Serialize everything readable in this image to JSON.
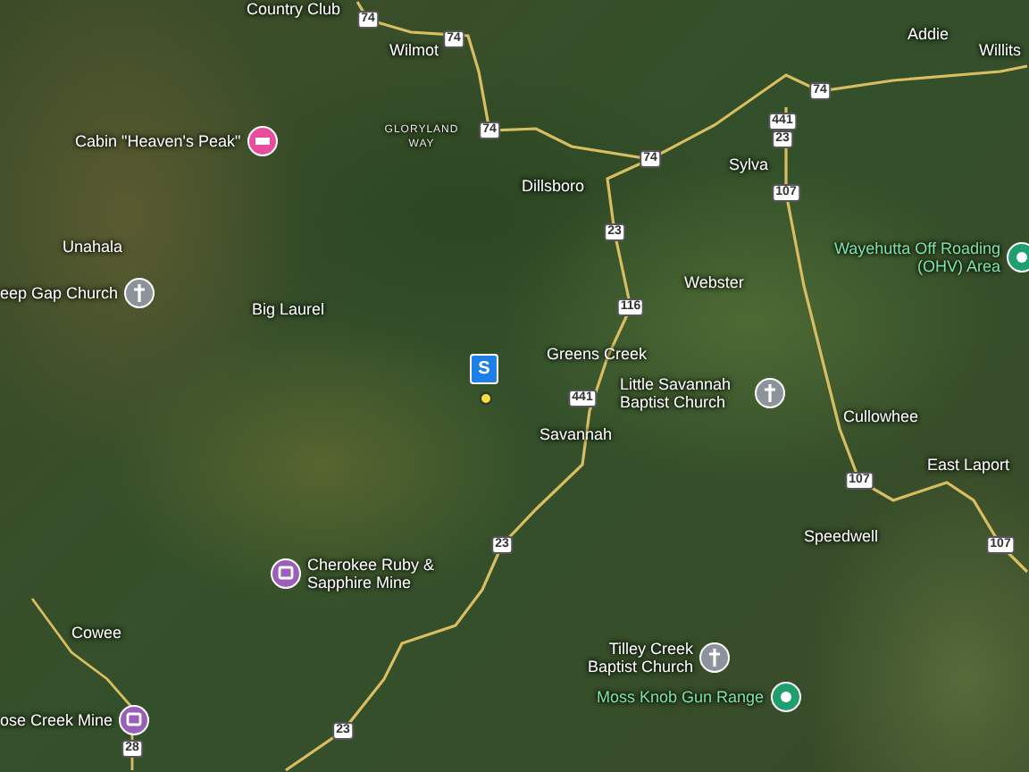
{
  "map": {
    "places": [
      {
        "name": "Country Club",
        "kind": "town"
      },
      {
        "name": "Wilmot",
        "kind": "town"
      },
      {
        "name": "Cabin \"Heaven's Peak\"",
        "kind": "lodging"
      },
      {
        "name": "GLORYLAND WAY",
        "kind": "road"
      },
      {
        "name": "Addie",
        "kind": "town"
      },
      {
        "name": "Willits",
        "kind": "town"
      },
      {
        "name": "Sylva",
        "kind": "town"
      },
      {
        "name": "Dillsboro",
        "kind": "town"
      },
      {
        "name": "Unahala",
        "kind": "town"
      },
      {
        "name": "Wayehutta Off Roading (OHV) Area",
        "kind": "park"
      },
      {
        "name": "Webster",
        "kind": "town"
      },
      {
        "name": "eep Gap Church",
        "kind": "church"
      },
      {
        "name": "Big Laurel",
        "kind": "town"
      },
      {
        "name": "Greens Creek",
        "kind": "town"
      },
      {
        "name": "Little Savannah Baptist Church",
        "kind": "church"
      },
      {
        "name": "Cullowhee",
        "kind": "town"
      },
      {
        "name": "Savannah",
        "kind": "town"
      },
      {
        "name": "East Laport",
        "kind": "town"
      },
      {
        "name": "Speedwell",
        "kind": "town"
      },
      {
        "name": "Cherokee Ruby & Sapphire Mine",
        "kind": "attraction"
      },
      {
        "name": "Cowee",
        "kind": "town"
      },
      {
        "name": "Tilley Creek Baptist Church",
        "kind": "church"
      },
      {
        "name": "Moss Knob Gun Range",
        "kind": "park"
      },
      {
        "name": "ose Creek Mine",
        "kind": "attraction"
      }
    ],
    "route_shields": [
      {
        "label": "74"
      },
      {
        "label": "74"
      },
      {
        "label": "74"
      },
      {
        "label": "74"
      },
      {
        "label": "74"
      },
      {
        "label": "441"
      },
      {
        "label": "23"
      },
      {
        "label": "107"
      },
      {
        "label": "23"
      },
      {
        "label": "116"
      },
      {
        "label": "441"
      },
      {
        "label": "23"
      },
      {
        "label": "23"
      },
      {
        "label": "28"
      },
      {
        "label": "107"
      },
      {
        "label": "107"
      }
    ],
    "listing_marker": {
      "label": "S"
    }
  }
}
